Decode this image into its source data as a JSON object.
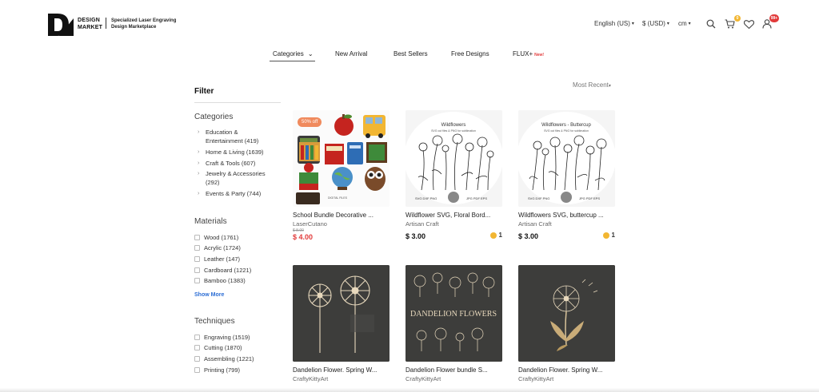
{
  "header": {
    "logo_top": "DESIGN",
    "logo_bottom": "MARKET",
    "tagline_1": "Specialized Laser Engraving",
    "tagline_2": "Design Marketplace",
    "language": "English (US)",
    "currency": "$ (USD)",
    "unit": "cm",
    "cart_count": "0",
    "notif_count": "99+"
  },
  "nav": {
    "items": [
      {
        "label": "Categories"
      },
      {
        "label": "New Arrival"
      },
      {
        "label": "Best Sellers"
      },
      {
        "label": "Free Designs"
      },
      {
        "label": "FLUX+"
      }
    ],
    "new_tag": "New!"
  },
  "sort": {
    "label": "Most Recent"
  },
  "filter": {
    "title": "Filter",
    "categories_title": "Categories",
    "categories": [
      {
        "label": "Education & Entertainment (419)"
      },
      {
        "label": "Home & Living (1639)"
      },
      {
        "label": "Craft & Tools (607)"
      },
      {
        "label": "Jewelry & Accessories (292)"
      },
      {
        "label": "Events & Party (744)"
      }
    ],
    "materials_title": "Materials",
    "materials": [
      {
        "label": "Wood (1761)"
      },
      {
        "label": "Acrylic (1724)"
      },
      {
        "label": "Leather (147)"
      },
      {
        "label": "Cardboard (1221)"
      },
      {
        "label": "Bamboo (1383)"
      }
    ],
    "show_more": "Show More",
    "techniques_title": "Techniques",
    "techniques": [
      {
        "label": "Engraving (1519)"
      },
      {
        "label": "Cutting (1870)"
      },
      {
        "label": "Assembling (1221)"
      },
      {
        "label": "Printing (799)"
      }
    ]
  },
  "products": [
    {
      "title": "School Bundle Decorative ...",
      "author": "LaserCutano",
      "old_price": "$ 8.00",
      "price": "$ 4.00",
      "badge": "50% off",
      "art_text": "DIGITAL FILES"
    },
    {
      "title": "Wildflower SVG, Floral Bord...",
      "author": "Artisan Craft",
      "price": "$ 3.00",
      "coins": "1",
      "art_title": "Wildflowers",
      "art_sub": "SVG cut files & PNG for sublimation",
      "art_foot_l": "SVG DXF PNG",
      "art_foot_r": "JPG PDF EPS"
    },
    {
      "title": "Wildflowers SVG, buttercup ...",
      "author": "Artisan Craft",
      "price": "$ 3.00",
      "coins": "1",
      "art_title": "Wildflowers - Buttercup",
      "art_sub": "SVG cut files & PNG for sublimation",
      "art_foot_l": "SVG DXF PNG",
      "art_foot_r": "JPG PDF EPS"
    },
    {
      "title": "Dandelion Flower. Spring W...",
      "author": "CraftyKittyArt"
    },
    {
      "title": "Dandelion Flower bundle S...",
      "author": "CraftyKittyArt",
      "art_title": "DANDELION FLOWERS"
    },
    {
      "title": "Dandelion Flower. Spring W...",
      "author": "CraftyKittyArt"
    }
  ],
  "colors": {
    "accent_red": "#e23b3b",
    "coin": "#f2b632",
    "link_blue": "#2c6ed5",
    "badge_orange": "#f08a5d"
  },
  "icons": [
    "search-icon",
    "cart-icon",
    "heart-icon",
    "user-icon",
    "chevron-down-icon",
    "chevron-right-icon"
  ]
}
